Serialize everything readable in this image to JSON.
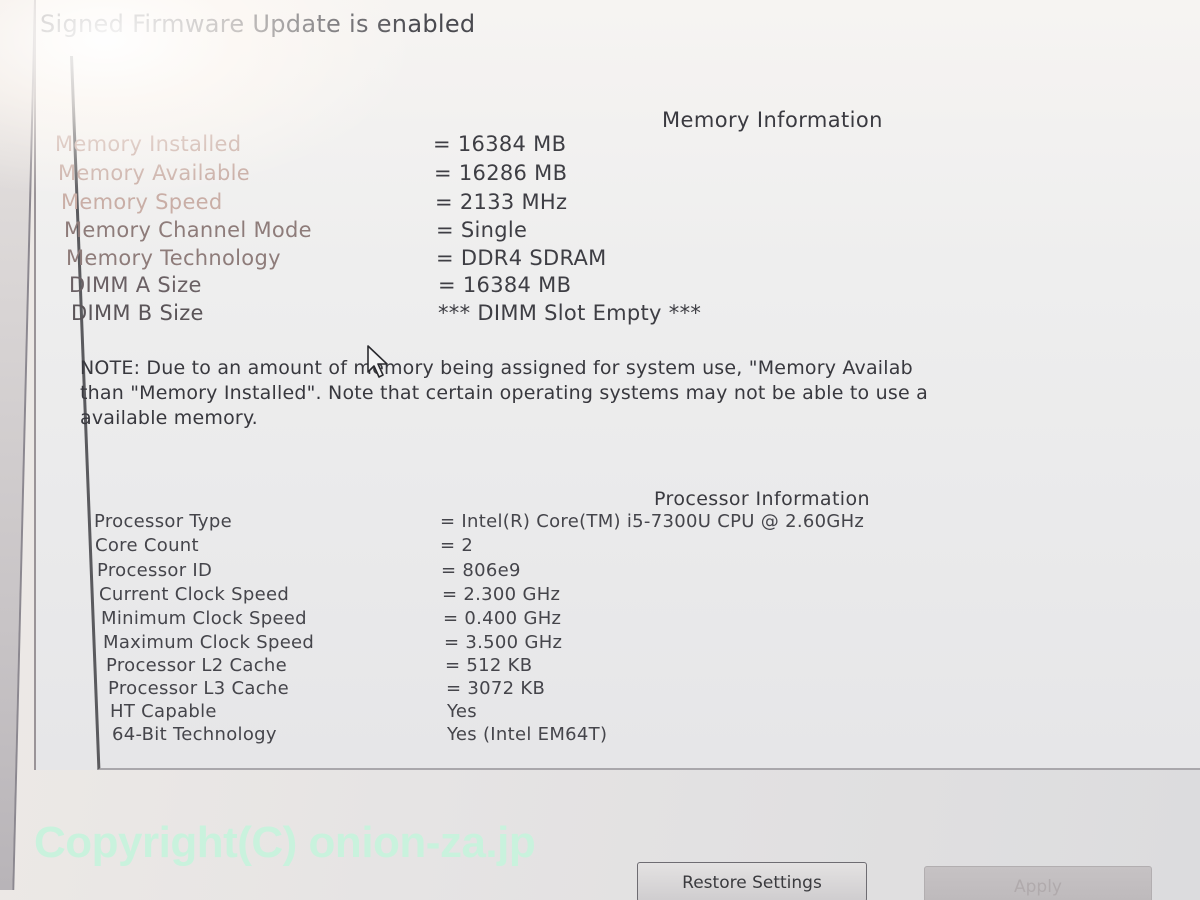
{
  "firmware_status": {
    "text": "Signed Firmware Update is enabled"
  },
  "memory": {
    "title": "Memory Information",
    "rows": [
      {
        "label": "Memory Installed",
        "value": "= 16384 MB"
      },
      {
        "label": "Memory Available",
        "value": "= 16286 MB"
      },
      {
        "label": "Memory Speed",
        "value": "= 2133 MHz"
      },
      {
        "label": "Memory Channel Mode",
        "value": "= Single"
      },
      {
        "label": "Memory Technology",
        "value": "= DDR4 SDRAM"
      },
      {
        "label": "DIMM A Size",
        "value": "= 16384 MB"
      },
      {
        "label": "DIMM B Size",
        "value": "*** DIMM Slot Empty ***"
      }
    ],
    "note_lines": [
      "NOTE: Due to an amount of memory being assigned for system use, \"Memory Availab",
      "than \"Memory Installed\". Note that certain operating systems may not be able to use a",
      "available memory."
    ]
  },
  "processor": {
    "title": "Processor Information",
    "rows": [
      {
        "label": "Processor Type",
        "value": "= Intel(R) Core(TM) i5-7300U CPU @ 2.60GHz"
      },
      {
        "label": "Core Count",
        "value": "= 2"
      },
      {
        "label": "Processor ID",
        "value": "= 806e9"
      },
      {
        "label": "Current Clock Speed",
        "value": "= 2.300 GHz"
      },
      {
        "label": "Minimum Clock Speed",
        "value": "= 0.400 GHz"
      },
      {
        "label": "Maximum Clock Speed",
        "value": "= 3.500 GHz"
      },
      {
        "label": "Processor L2 Cache",
        "value": "= 512 KB"
      },
      {
        "label": "Processor L3 Cache",
        "value": "= 3072 KB"
      },
      {
        "label": "HT Capable",
        "value": "Yes"
      },
      {
        "label": "64-Bit Technology",
        "value": "Yes (Intel EM64T)"
      }
    ]
  },
  "watermark": {
    "text": "Copyright(C) onion-za.jp",
    "color": "#c9f2dd"
  },
  "buttons": {
    "restore_label": "Restore Settings",
    "apply_label": "Apply"
  },
  "cursor": {
    "icon": "arrow-pointer-icon"
  }
}
